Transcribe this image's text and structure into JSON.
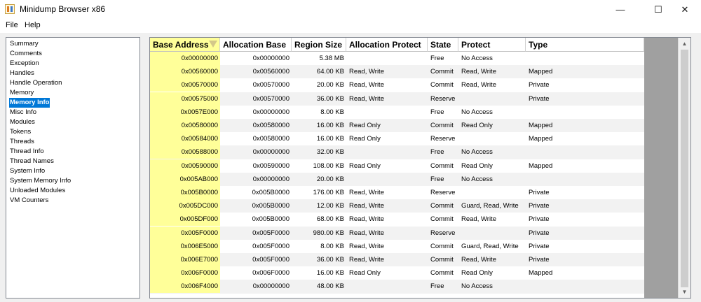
{
  "window": {
    "title": "Minidump Browser x86",
    "minimize_glyph": "—",
    "maximize_glyph": "☐",
    "close_glyph": "✕"
  },
  "menu": [
    "File",
    "Help"
  ],
  "left_list": [
    "Summary",
    "Comments",
    "Exception",
    "Handles",
    "Handle Operation",
    "Memory",
    "Memory Info",
    "Misc Info",
    "Modules",
    "Tokens",
    "Threads",
    "Thread Info",
    "Thread Names",
    "System Info",
    "System Memory Info",
    "Unloaded Modules",
    "VM Counters"
  ],
  "selected_item": "Memory Info",
  "grid": {
    "columns": [
      "Base Address",
      "Allocation Base",
      "Region Size",
      "Allocation Protect",
      "State",
      "Protect",
      "Type"
    ],
    "sorted_column": "Base Address",
    "rows": [
      [
        "0x00000000",
        "0x00000000",
        "5.38 MB",
        "",
        "Free",
        "No Access",
        ""
      ],
      [
        "0x00560000",
        "0x00560000",
        "64.00 KB",
        "Read, Write",
        "Commit",
        "Read, Write",
        "Mapped"
      ],
      [
        "0x00570000",
        "0x00570000",
        "20.00 KB",
        "Read, Write",
        "Commit",
        "Read, Write",
        "Private"
      ],
      [
        "0x00575000",
        "0x00570000",
        "36.00 KB",
        "Read, Write",
        "Reserve",
        "",
        "Private"
      ],
      [
        "0x0057E000",
        "0x00000000",
        "8.00 KB",
        "",
        "Free",
        "No Access",
        ""
      ],
      [
        "0x00580000",
        "0x00580000",
        "16.00 KB",
        "Read Only",
        "Commit",
        "Read Only",
        "Mapped"
      ],
      [
        "0x00584000",
        "0x00580000",
        "16.00 KB",
        "Read Only",
        "Reserve",
        "",
        "Mapped"
      ],
      [
        "0x00588000",
        "0x00000000",
        "32.00 KB",
        "",
        "Free",
        "No Access",
        ""
      ],
      [
        "0x00590000",
        "0x00590000",
        "108.00 KB",
        "Read Only",
        "Commit",
        "Read Only",
        "Mapped"
      ],
      [
        "0x005AB000",
        "0x00000000",
        "20.00 KB",
        "",
        "Free",
        "No Access",
        ""
      ],
      [
        "0x005B0000",
        "0x005B0000",
        "176.00 KB",
        "Read, Write",
        "Reserve",
        "",
        "Private"
      ],
      [
        "0x005DC000",
        "0x005B0000",
        "12.00 KB",
        "Read, Write",
        "Commit",
        "Guard, Read, Write",
        "Private"
      ],
      [
        "0x005DF000",
        "0x005B0000",
        "68.00 KB",
        "Read, Write",
        "Commit",
        "Read, Write",
        "Private"
      ],
      [
        "0x005F0000",
        "0x005F0000",
        "980.00 KB",
        "Read, Write",
        "Reserve",
        "",
        "Private"
      ],
      [
        "0x006E5000",
        "0x005F0000",
        "8.00 KB",
        "Read, Write",
        "Commit",
        "Guard, Read, Write",
        "Private"
      ],
      [
        "0x006E7000",
        "0x005F0000",
        "36.00 KB",
        "Read, Write",
        "Commit",
        "Read, Write",
        "Private"
      ],
      [
        "0x006F0000",
        "0x006F0000",
        "16.00 KB",
        "Read Only",
        "Commit",
        "Read Only",
        "Mapped"
      ],
      [
        "0x006F4000",
        "0x00000000",
        "48.00 KB",
        "",
        "Free",
        "No Access",
        ""
      ]
    ]
  },
  "scrollbar": {
    "up_glyph": "▲",
    "down_glyph": "▼"
  },
  "icons": {
    "app": "minidump-app-icon",
    "sort": "sort-descending-icon"
  },
  "colors": {
    "selection": "#0078d7",
    "sorted_column": "#ffff99"
  }
}
